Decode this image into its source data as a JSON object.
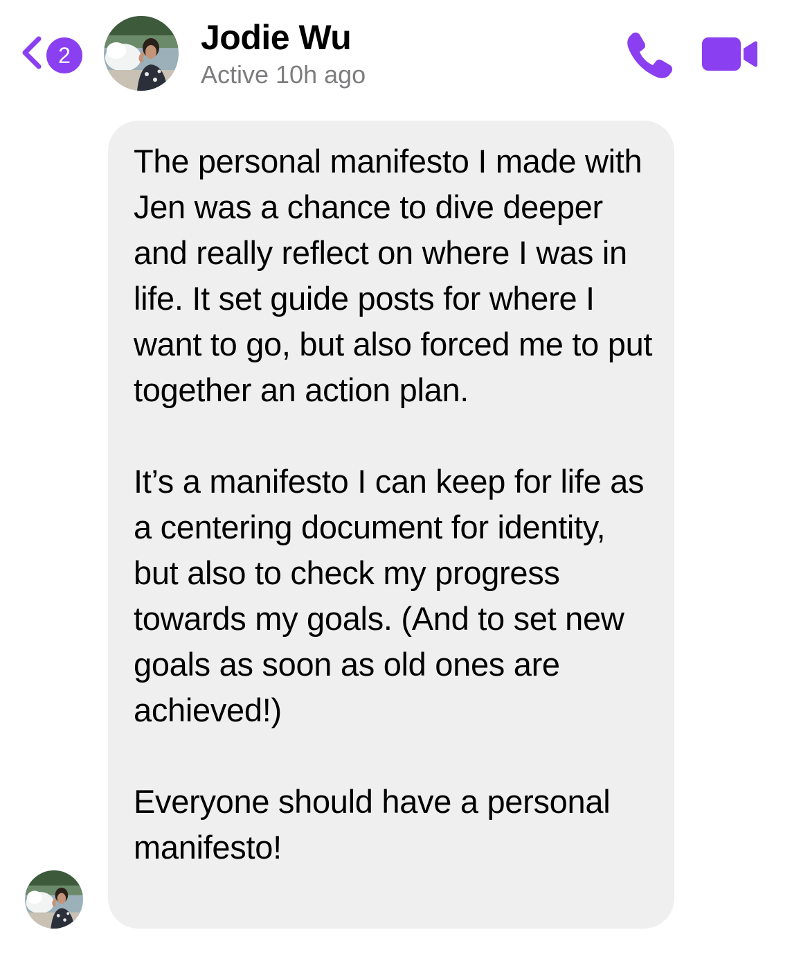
{
  "header": {
    "back_icon": "chevron-left-icon",
    "unread_count": "2",
    "contact_name": "Jodie Wu",
    "contact_status": "Active 10h ago",
    "call_icon": "phone-icon",
    "video_icon": "video-camera-icon",
    "accent_color": "#8a3ff0"
  },
  "conversation": {
    "messages": [
      {
        "sender": "Jodie Wu",
        "bubble_color": "#efeff0",
        "paragraphs": [
          "The personal manifesto I made with Jen was a chance to dive deeper and really reflect on where I was in life. It set guide posts for where I want to go, but also forced me to put together an action plan.",
          "It’s a manifesto I can keep for life as a centering document for identity, but also to check my progress towards my goals. (And to set new goals as soon as old ones are achieved!)",
          "Everyone should have a personal manifesto!"
        ]
      }
    ]
  }
}
